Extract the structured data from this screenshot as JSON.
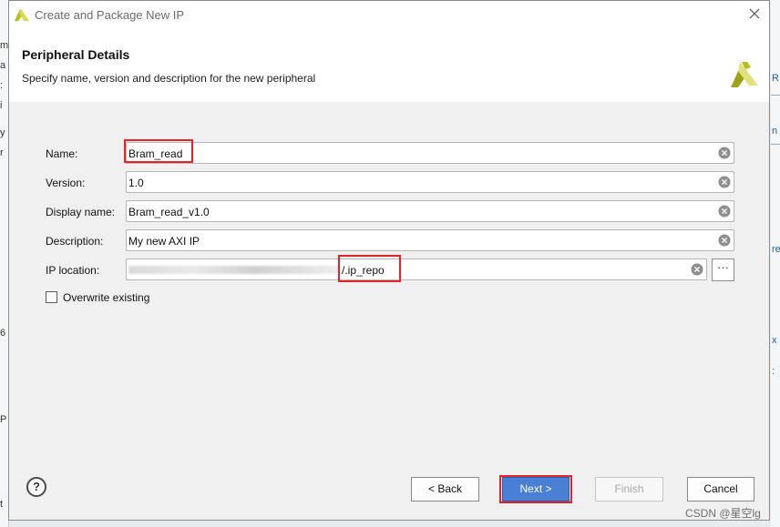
{
  "window": {
    "title": "Create and Package New IP"
  },
  "header": {
    "title": "Peripheral Details",
    "subtitle": "Specify name, version and description for the new peripheral"
  },
  "form": {
    "name_label": "Name:",
    "name_value": "Bram_read",
    "version_label": "Version:",
    "version_value": "1.0",
    "display_name_label": "Display name:",
    "display_name_value": "Bram_read_v1.0",
    "description_label": "Description:",
    "description_value": "My new AXI IP",
    "ip_location_label": "IP location:",
    "ip_location_value": "/.ip_repo",
    "browse_label": "···",
    "overwrite_label": "Overwrite existing",
    "overwrite_checked": false
  },
  "footer": {
    "help_label": "?",
    "back_label": "< Back",
    "next_label": "Next >",
    "finish_label": "Finish",
    "cancel_label": "Cancel"
  },
  "watermark": "CSDN @星空lg",
  "colors": {
    "accent": "#4a7fd6",
    "highlight": "#e0242a",
    "logo": "#b5bd1f"
  }
}
